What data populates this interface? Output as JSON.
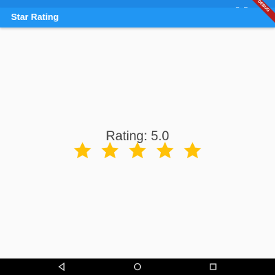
{
  "app_bar": {
    "title": "Star Rating",
    "background_color": "#2196f3",
    "debug_banner": "DEBUG"
  },
  "main": {
    "rating_text": "Rating: 5.0",
    "rating_value": 5.0,
    "star_count": 5,
    "star_color": "#ffc107",
    "stars": [
      {
        "icon": "star-icon",
        "filled": true
      },
      {
        "icon": "star-icon",
        "filled": true
      },
      {
        "icon": "star-icon",
        "filled": true
      },
      {
        "icon": "star-icon",
        "filled": true
      },
      {
        "icon": "star-icon",
        "filled": true
      }
    ]
  },
  "nav_bar": {
    "buttons": [
      {
        "icon": "back-triangle-icon"
      },
      {
        "icon": "home-circle-icon"
      },
      {
        "icon": "recent-apps-square-icon"
      }
    ]
  }
}
